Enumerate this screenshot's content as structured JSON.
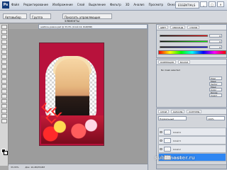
{
  "app": {
    "logo": "Ps",
    "menu": [
      "Файл",
      "Редактирование",
      "Изображение",
      "Слой",
      "Выделение",
      "Фильтр",
      "3D",
      "Анализ",
      "Просмотр",
      "Окно",
      "Справка"
    ],
    "workspace": "ESSENTIALS",
    "window_buttons": [
      "_",
      "□",
      "×"
    ]
  },
  "options": {
    "tool": "Автовыбор",
    "mode": "Группа",
    "controls": "Показать управляющие элементы"
  },
  "document": {
    "tab": "шаблон-рамка.psd @ 33,3% (Слой 14, RGB/8#)",
    "status": "Док: 10,4M/35,8M",
    "zoom": "33,33%"
  },
  "panels": {
    "color": {
      "tabs": [
        "ЦВЕТ",
        "ОБРАЗЦЫ",
        "СТИЛИ"
      ],
      "r": "0",
      "g": "0",
      "b": "0"
    },
    "adjustments": {
      "tabs": [
        "КОРРЕКЦИЯ",
        "МАСКИ"
      ],
      "preset": "No mask selected",
      "buttons": [
        "Pixel Mask",
        "Vector Mask",
        "Color Range",
        "Invert"
      ]
    },
    "layers": {
      "tabs": [
        "СЛОИ",
        "КАНАЛЫ",
        "КОНТУРЫ"
      ],
      "blend_mode": "Нормальный",
      "opacity": "100%",
      "items": [
        {
          "name": "Слой 4"
        },
        {
          "name": "Слой 3"
        },
        {
          "name": "Слой 2"
        },
        {
          "name": "Слой 14"
        }
      ]
    }
  },
  "watermark": "sublimaster.ru"
}
